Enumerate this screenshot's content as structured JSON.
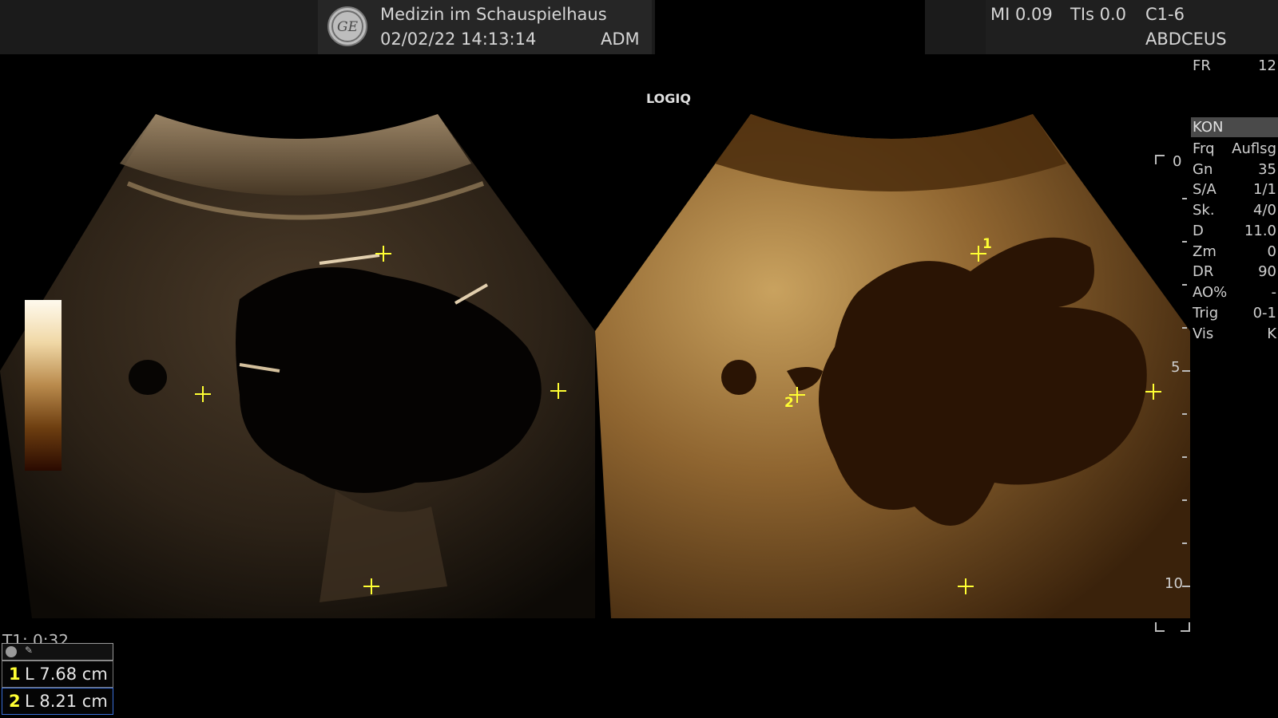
{
  "header": {
    "institution": "Medizin im Schauspielhaus",
    "datetime": "02/02/22 14:13:14",
    "operator": "ADM",
    "mi": "MI 0.09",
    "tis": "TIs 0.0",
    "probe": "C1-6",
    "preset": "ABDCEUS"
  },
  "brand": "LOGIQ",
  "params": {
    "fr_key": "FR",
    "fr_val": "12",
    "mode": "KON",
    "rows": [
      {
        "key": "Frq",
        "val": "Auflsg"
      },
      {
        "key": "Gn",
        "val": "35"
      },
      {
        "key": "S/A",
        "val": "1/1"
      },
      {
        "key": "Sk.",
        "val": "4/0"
      },
      {
        "key": "D",
        "val": "11.0"
      },
      {
        "key": "Zm",
        "val": "0"
      },
      {
        "key": "DR",
        "val": "90"
      },
      {
        "key": "AO%",
        "val": "-"
      },
      {
        "key": "Trig",
        "val": "0-1"
      },
      {
        "key": "Vis",
        "val": "K"
      }
    ]
  },
  "depth_scale": {
    "top": "0",
    "mid": "5",
    "bottom": "10"
  },
  "caliper_labels": {
    "a": "1",
    "b": "2"
  },
  "timer": "T1: 0:32",
  "measurements": [
    {
      "num": "1",
      "text": "L  7.68 cm"
    },
    {
      "num": "2",
      "text": "L  8.21 cm"
    }
  ],
  "icons": [
    "ge-logo-icon",
    "record-dot-icon",
    "caliper-cursor-icon"
  ]
}
